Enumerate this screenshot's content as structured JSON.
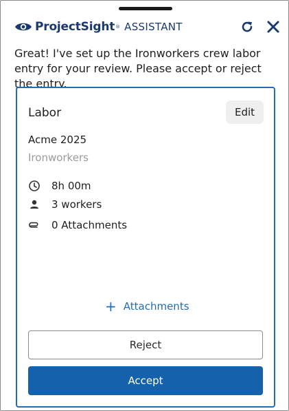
{
  "header": {
    "brand": "ProjectSight",
    "brand_mark": "®",
    "assistant_label": "ASSISTANT",
    "refresh_icon": "refresh-icon",
    "close_icon": "close-icon"
  },
  "message": "Great! I've set up the Ironworkers crew labor entry for your review. Please accept or reject the entry.",
  "card": {
    "title": "Labor",
    "edit_label": "Edit",
    "project": "Acme 2025",
    "crew": "Ironworkers",
    "details": [
      {
        "icon": "clock-icon",
        "text": "8h 00m"
      },
      {
        "icon": "person-icon",
        "text": "3 workers"
      },
      {
        "icon": "paperclip-icon",
        "text": "0 Attachments"
      }
    ],
    "add_attachments_label": "Attachments",
    "reject_label": "Reject",
    "accept_label": "Accept"
  },
  "colors": {
    "accent": "#1f6db5",
    "accept_bg": "#1561ab",
    "brand": "#1a3a6e",
    "muted_text": "#9a9a9a"
  }
}
